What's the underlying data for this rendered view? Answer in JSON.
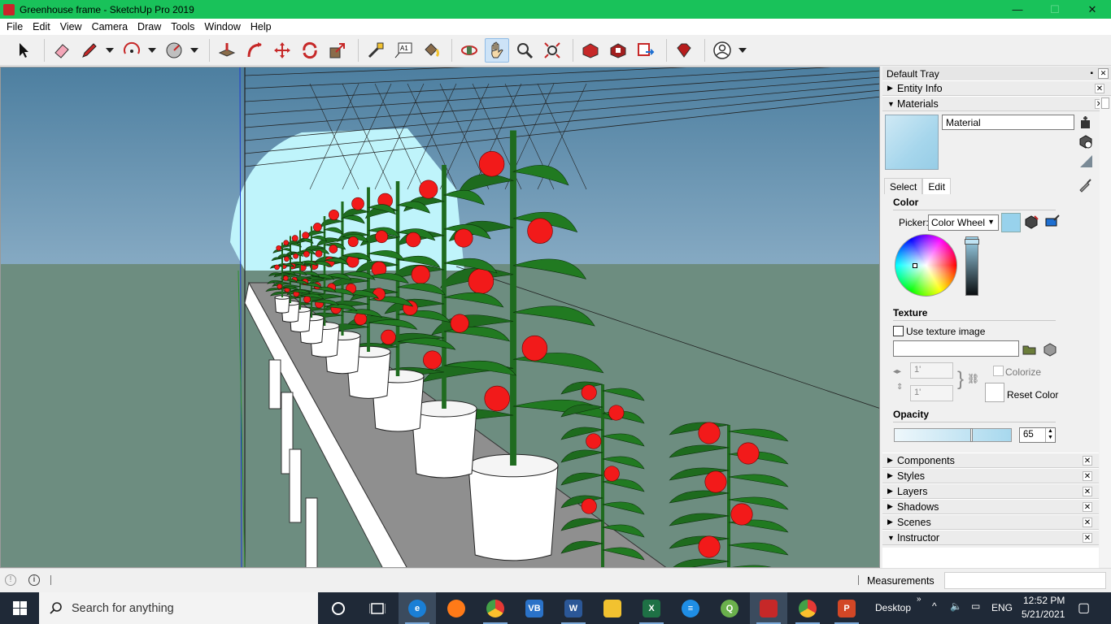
{
  "window": {
    "title": "Greenhouse frame - SketchUp Pro 2019",
    "min_glyph": "—",
    "max_glyph": "☐",
    "close_glyph": "✕"
  },
  "menu": [
    "File",
    "Edit",
    "View",
    "Camera",
    "Draw",
    "Tools",
    "Window",
    "Help"
  ],
  "toolbar": {
    "tools": [
      {
        "name": "select-tool"
      },
      {
        "name": "eraser-tool"
      },
      {
        "name": "pencil-tool"
      },
      {
        "name": "arc-tool"
      },
      {
        "name": "shape-tool"
      },
      {
        "name": "push-pull-tool"
      },
      {
        "name": "follow-me-tool"
      },
      {
        "name": "move-tool"
      },
      {
        "name": "rotate-tool"
      },
      {
        "name": "scale-tool"
      },
      {
        "name": "tape-measure-tool"
      },
      {
        "name": "text-tool"
      },
      {
        "name": "paint-bucket-tool"
      },
      {
        "name": "orbit-tool"
      },
      {
        "name": "pan-tool"
      },
      {
        "name": "zoom-tool"
      },
      {
        "name": "zoom-extents-tool"
      },
      {
        "name": "3d-warehouse"
      },
      {
        "name": "extension-warehouse"
      },
      {
        "name": "layout-send"
      },
      {
        "name": "ruby-extension"
      },
      {
        "name": "account"
      }
    ],
    "text_tool_label": "A1"
  },
  "tray": {
    "title": "Default Tray",
    "close_glyph": "✕",
    "entity_info": "Entity Info",
    "materials": "Materials",
    "material_name": "Material",
    "tabs": [
      "Select",
      "Edit"
    ],
    "color_title": "Color",
    "picker_label": "Picker:",
    "picker_value": "Color Wheel",
    "color_hex": "#98d2ec",
    "texture_title": "Texture",
    "use_texture_label": "Use texture image",
    "texture_path": "",
    "width_value": "1'",
    "height_value": "1'",
    "colorize_label": "Colorize",
    "reset_color_label": "Reset Color",
    "opacity_title": "Opacity",
    "opacity_value": "65",
    "panels": [
      "Components",
      "Styles",
      "Layers",
      "Shadows",
      "Scenes",
      "Instructor"
    ]
  },
  "status": {
    "measurements_label": "Measurements",
    "measurements_value": ""
  },
  "taskbar": {
    "search_placeholder": "Search for anything",
    "desktop_label": "Desktop",
    "language": "ENG",
    "time": "12:52 PM",
    "date": "5/21/2021"
  }
}
